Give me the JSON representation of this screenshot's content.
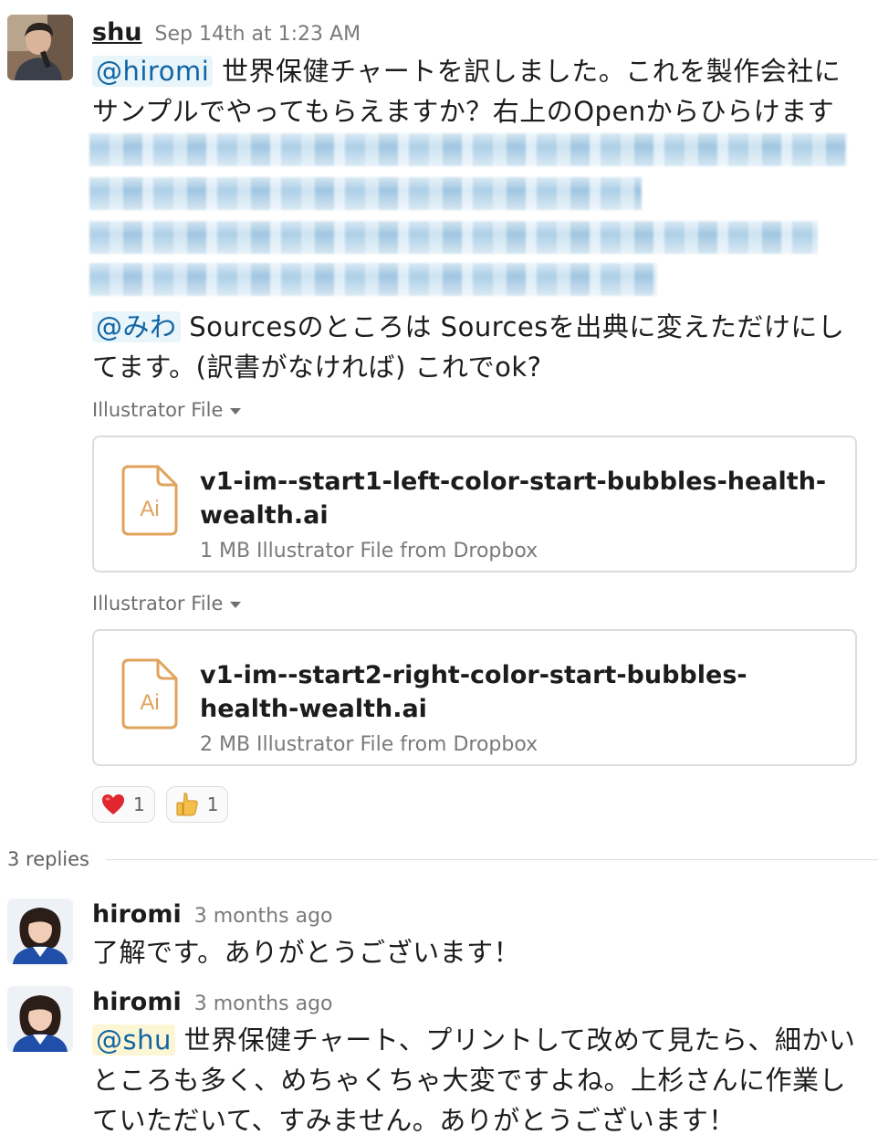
{
  "main_message": {
    "author": "shu",
    "timestamp": "Sep 14th at 1:23 AM",
    "mention_1": "@hiromi",
    "text_1": " 世界保健チャートを訳しました。これを製作会社にサンプルでやってもらえますか？右上のOpenからひらけます",
    "mention_2": "@みわ",
    "text_2": " Sourcesのところは Sourcesを出典に変えただけにしてます。(訳書がなければ) これでok?"
  },
  "files": [
    {
      "label": "Illustrator File",
      "icon": "illustrator-file-icon",
      "icon_text": "Ai",
      "name": "v1-im--start1-left-color-start-bubbles-health-wealth.ai",
      "meta": "1 MB Illustrator File from Dropbox"
    },
    {
      "label": "Illustrator File",
      "icon": "illustrator-file-icon",
      "icon_text": "Ai",
      "name": "v1-im--start2-right-color-start-bubbles-health-wealth.ai",
      "meta": "2 MB Illustrator File from Dropbox"
    }
  ],
  "reactions": [
    {
      "emoji": "heart-emoji-icon",
      "count": "1"
    },
    {
      "emoji": "thumbs-up-emoji-icon",
      "count": "1"
    }
  ],
  "replies": {
    "label": "3 replies"
  },
  "reply_1": {
    "author": "hiromi",
    "timestamp": "3 months ago",
    "text": "了解です。ありがとうございます！"
  },
  "reply_2": {
    "author": "hiromi",
    "timestamp": "3 months ago",
    "mention": "@shu",
    "text": " 世界保健チャート、プリントして改めて見たら、細かいところも多く、めちゃくちゃ大変ですよね。上杉さんに作業していただいて、すみません。ありがとうございます！"
  },
  "colors": {
    "mention_bg": "#e8f5fa",
    "mention_text": "#1264a3",
    "self_mention_bg": "#fdf6d5",
    "illustrator_orange": "#e0a35c"
  }
}
